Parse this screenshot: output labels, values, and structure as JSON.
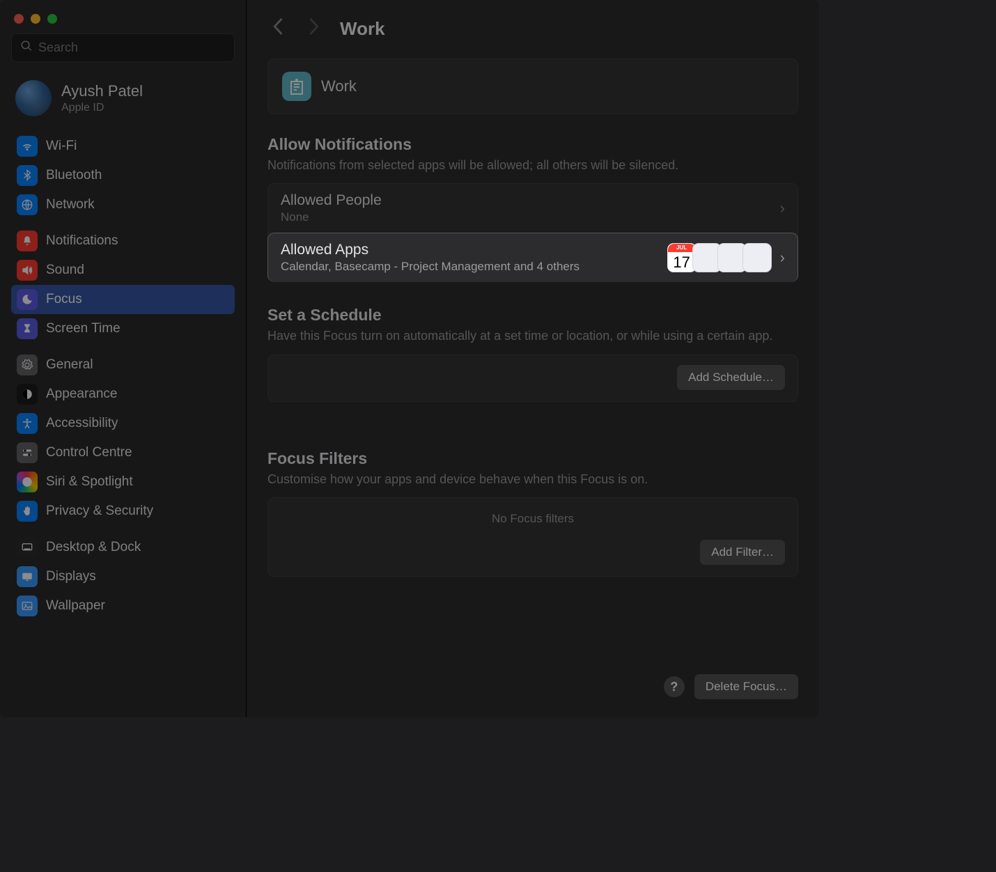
{
  "window": {
    "search_placeholder": "Search"
  },
  "account": {
    "name": "Ayush Patel",
    "sub": "Apple ID"
  },
  "sidebar": [
    {
      "label": "Wi-Fi",
      "icon": "wifi",
      "color": "ic-blue"
    },
    {
      "label": "Bluetooth",
      "icon": "bluetooth",
      "color": "ic-blue"
    },
    {
      "label": "Network",
      "icon": "network",
      "color": "ic-blue"
    },
    {
      "label": "Notifications",
      "icon": "bell",
      "color": "ic-red"
    },
    {
      "label": "Sound",
      "icon": "sound",
      "color": "ic-red"
    },
    {
      "label": "Focus",
      "icon": "moon",
      "color": "ic-purple",
      "selected": true
    },
    {
      "label": "Screen Time",
      "icon": "hourglass",
      "color": "ic-purple"
    },
    {
      "label": "General",
      "icon": "gear",
      "color": "ic-grey"
    },
    {
      "label": "Appearance",
      "icon": "contrast",
      "color": "ic-black"
    },
    {
      "label": "Accessibility",
      "icon": "accessibility",
      "color": "ic-blue"
    },
    {
      "label": "Control Centre",
      "icon": "switches",
      "color": "ic-grey"
    },
    {
      "label": "Siri & Spotlight",
      "icon": "siri",
      "color": "ic-multi"
    },
    {
      "label": "Privacy & Security",
      "icon": "hand",
      "color": "ic-blue"
    },
    {
      "label": "Desktop & Dock",
      "icon": "dock",
      "color": "ic-dark"
    },
    {
      "label": "Displays",
      "icon": "display",
      "color": "ic-ltblue"
    },
    {
      "label": "Wallpaper",
      "icon": "wallpaper",
      "color": "ic-ltblue"
    }
  ],
  "header": {
    "title": "Work"
  },
  "banner": {
    "focus_name": "Work"
  },
  "allow": {
    "section_title": "Allow Notifications",
    "section_sub": "Notifications from selected apps will be allowed; all others will be silenced.",
    "people": {
      "title": "Allowed People",
      "sub": "None"
    },
    "apps": {
      "title": "Allowed Apps",
      "sub": "Calendar, Basecamp - Project Management and 4 others",
      "cal_month": "JUL",
      "cal_day": "17"
    }
  },
  "schedule": {
    "section_title": "Set a Schedule",
    "section_sub": "Have this Focus turn on automatically at a set time or location, or while using a certain app.",
    "add_btn": "Add Schedule…"
  },
  "filters": {
    "section_title": "Focus Filters",
    "section_sub": "Customise how your apps and device behave when this Focus is on.",
    "empty": "No Focus filters",
    "add_btn": "Add Filter…"
  },
  "footer": {
    "help": "?",
    "delete_btn": "Delete Focus…"
  }
}
